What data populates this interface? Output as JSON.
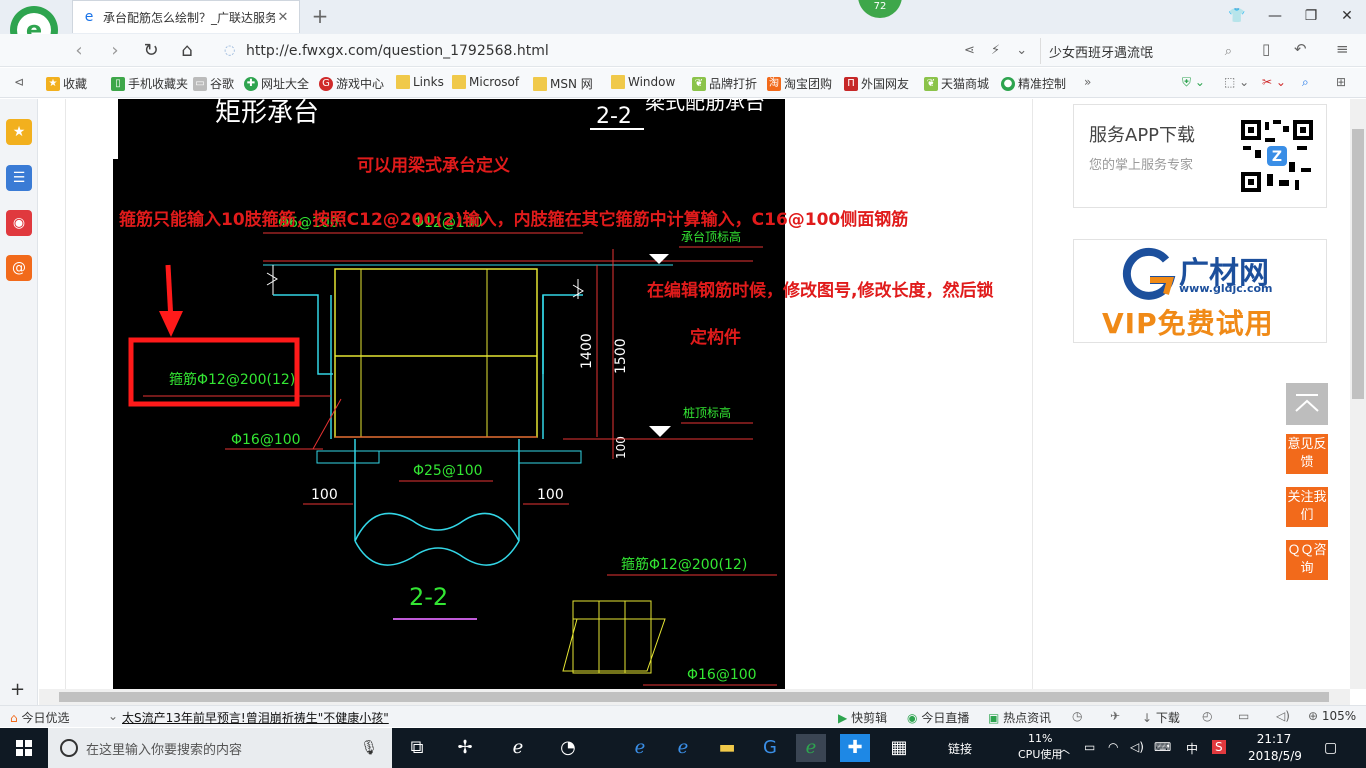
{
  "browser": {
    "tab_title": "承台配筋怎么绘制？_广联达服务",
    "badge_count": "72",
    "url": "http://e.fwxgx.com/question_1792568.html",
    "hot_search": "少女西班牙遇流氓",
    "zoom": "105%"
  },
  "bookmarks": [
    {
      "label": "收藏",
      "icon": "star-icon",
      "color": "#f2b01e"
    },
    {
      "label": "手机收藏夹",
      "icon": "phone-icon",
      "color": "#3ea74a"
    },
    {
      "label": "谷歌",
      "icon": "page-icon",
      "color": "#999999"
    },
    {
      "label": "网址大全",
      "icon": "globe-icon",
      "color": "#2ea44f"
    },
    {
      "label": "游戏中心",
      "icon": "game-icon",
      "color": "#d02a2a"
    },
    {
      "label": "Links",
      "icon": "folder-icon",
      "color": "#f0c94a"
    },
    {
      "label": "Microsof",
      "icon": "folder-icon",
      "color": "#f0c94a"
    },
    {
      "label": "MSN 网",
      "icon": "folder-icon",
      "color": "#f0c94a"
    },
    {
      "label": "Window",
      "icon": "folder-icon",
      "color": "#f0c94a"
    },
    {
      "label": "品牌打折",
      "icon": "leaf-icon",
      "color": "#8bc34a"
    },
    {
      "label": "淘宝团购",
      "icon": "taobao-icon",
      "color": "#f26a1b"
    },
    {
      "label": "外国网友",
      "icon": "flag-icon",
      "color": "#c62828"
    },
    {
      "label": "天猫商城",
      "icon": "leaf-icon",
      "color": "#8bc34a"
    },
    {
      "label": "精准控制",
      "icon": "chat-icon",
      "color": "#2ea44f"
    }
  ],
  "drawing": {
    "title_left": "矩形承台",
    "title_right_num": "2-2",
    "title_right_text": "梁式配筋承台",
    "stirrup_label": "箍筋Φ12@200(12)",
    "side_rebar": "Φ16@100",
    "top_label_a": "Φ6@100",
    "top_label_b": "Φ12@100",
    "cap_top": "承台顶标高",
    "pile_top": "桩顶标高",
    "dim_1400": "1400",
    "dim_1500": "1500",
    "dim_100": "100",
    "pile_rebar": "Φ25@100",
    "section_name": "2-2",
    "stirrup_label_2": "箍筋Φ12@200(12)",
    "side_rebar_2": "Φ16@100"
  },
  "annotations": {
    "line1": "可以用梁式承台定义",
    "line2": "箍筋只能输入10肢箍筋，按照C12@200(2)输入，内肢箍在其它箍筋中计算输入，C16@100侧面钢筋",
    "line3": "在编辑钢筋时候，修改图号,修改长度，然后锁",
    "line4": "定构件"
  },
  "sidebar_ads": {
    "app_title": "服务APP下载",
    "app_sub": "您的掌上服务专家",
    "brand": "广材网",
    "brand_site": "www.gldjc.com",
    "vip": "VIP免费试用"
  },
  "float_buttons": [
    "意见反馈",
    "关注我们",
    "ＱＱ咨询"
  ],
  "status": {
    "today": "今日优选",
    "news": "太S流产13年前早预言!曾泪崩祈祷生\"不健康小孩\"",
    "quick_edit": "快剪辑",
    "live": "今日直播",
    "hot_news": "热点资讯",
    "download": "下载",
    "zoom": "105%"
  },
  "taskbar": {
    "search_placeholder": "在这里输入你要搜索的内容",
    "link_label": "链接",
    "cpu_pct": "11%",
    "cpu_label": "CPU使用",
    "ime": "中",
    "time": "21:17",
    "date": "2018/5/9"
  },
  "colors": {
    "annotation_red": "#e01b1b",
    "cad_bg": "#000000",
    "cad_green": "#33e633",
    "cad_yellow": "#e6e633",
    "cad_cyan": "#33d6e6",
    "cad_red": "#e63333",
    "float_orange": "#f26a1b"
  }
}
